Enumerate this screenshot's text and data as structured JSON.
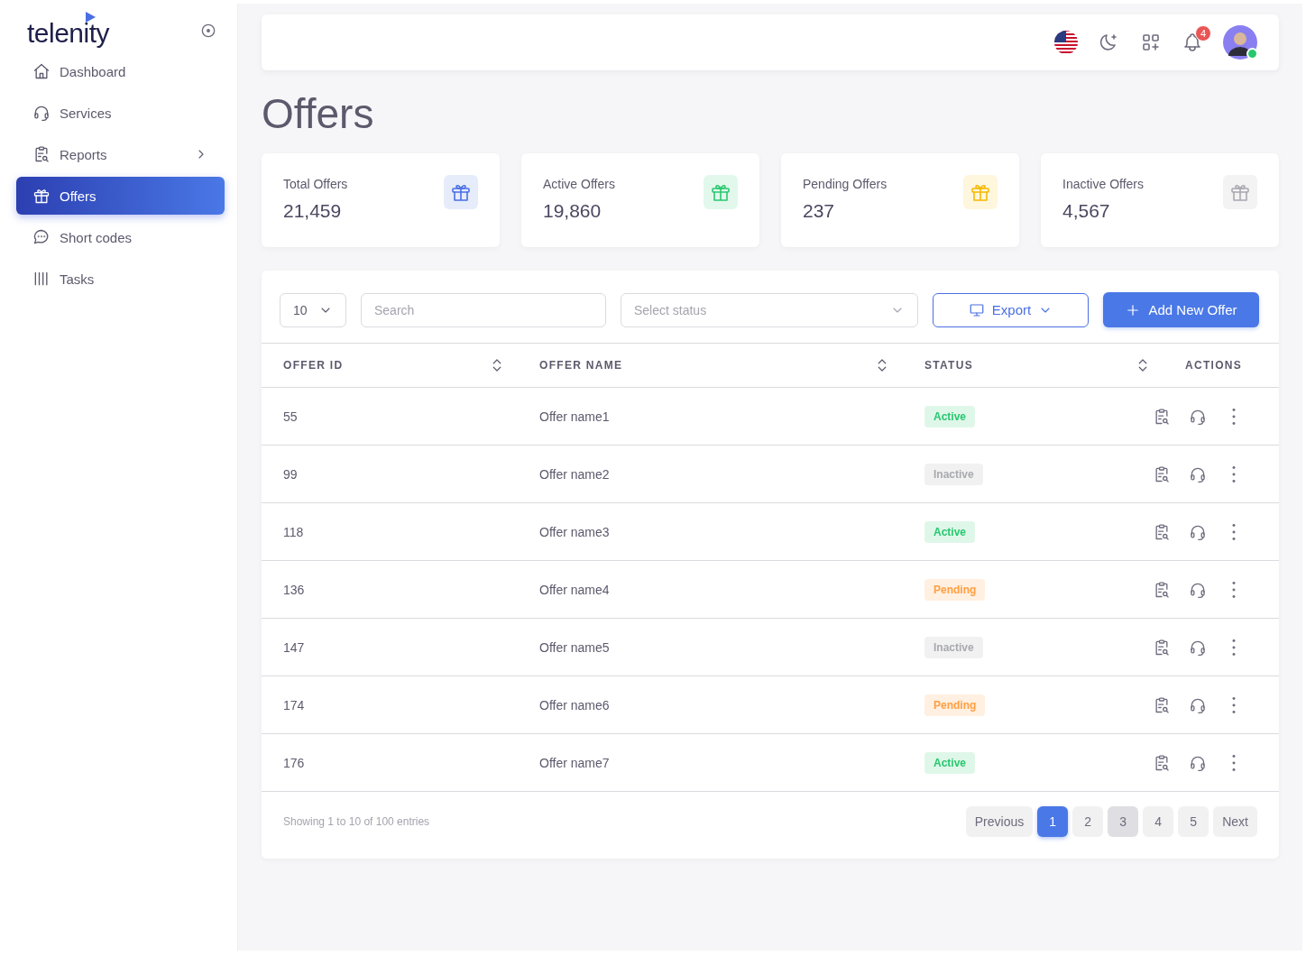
{
  "sidebar": {
    "logo": "telenity",
    "items": [
      {
        "label": "Dashboard",
        "selected": false,
        "has_submenu": false
      },
      {
        "label": "Services",
        "selected": false,
        "has_submenu": false
      },
      {
        "label": "Reports",
        "selected": false,
        "has_submenu": true
      },
      {
        "label": "Offers",
        "selected": true,
        "has_submenu": false
      },
      {
        "label": "Short codes",
        "selected": false,
        "has_submenu": false
      },
      {
        "label": "Tasks",
        "selected": false,
        "has_submenu": false
      }
    ]
  },
  "header": {
    "notification_count": "4",
    "user_online": true
  },
  "page_title": "Offers",
  "stats": [
    {
      "label": "Total Offers",
      "value": "21,459",
      "color": "#4a6fe3"
    },
    {
      "label": "Active Offers",
      "value": "19,860",
      "color": "#28c76f"
    },
    {
      "label": "Pending Offers",
      "value": "237",
      "color": "#f5b800"
    },
    {
      "label": "Inactive Offers",
      "value": "4,567",
      "color": "#a8a8b0"
    }
  ],
  "toolbar": {
    "page_size": "10",
    "search_placeholder": "Search",
    "status_placeholder": "Select status",
    "export_label": "Export",
    "add_label": "Add New Offer"
  },
  "table": {
    "columns": [
      {
        "label": "OFFER ID",
        "sortable": true
      },
      {
        "label": "OFFER NAME",
        "sortable": true
      },
      {
        "label": "STATUS",
        "sortable": true
      },
      {
        "label": "ACTIONS",
        "sortable": false
      }
    ],
    "rows": [
      {
        "id": "55",
        "name": "Offer name1",
        "status": "Active",
        "kind": "active"
      },
      {
        "id": "99",
        "name": "Offer name2",
        "status": "Inactive",
        "kind": "inactive"
      },
      {
        "id": "118",
        "name": "Offer name3",
        "status": "Active",
        "kind": "active"
      },
      {
        "id": "136",
        "name": "Offer name4",
        "status": "Pending",
        "kind": "pending"
      },
      {
        "id": "147",
        "name": "Offer name5",
        "status": "Inactive",
        "kind": "inactive"
      },
      {
        "id": "174",
        "name": "Offer name6",
        "status": "Pending",
        "kind": "pending"
      },
      {
        "id": "176",
        "name": "Offer name7",
        "status": "Active",
        "kind": "active"
      }
    ]
  },
  "footer": {
    "summary": "Showing 1 to 10 of 100 entries",
    "previous": "Previous",
    "next": "Next",
    "pages": [
      {
        "label": "1",
        "selected": true,
        "hovered": false
      },
      {
        "label": "2",
        "selected": false,
        "hovered": false
      },
      {
        "label": "3",
        "selected": false,
        "hovered": true
      },
      {
        "label": "4",
        "selected": false,
        "hovered": false
      },
      {
        "label": "5",
        "selected": false,
        "hovered": false
      }
    ]
  }
}
